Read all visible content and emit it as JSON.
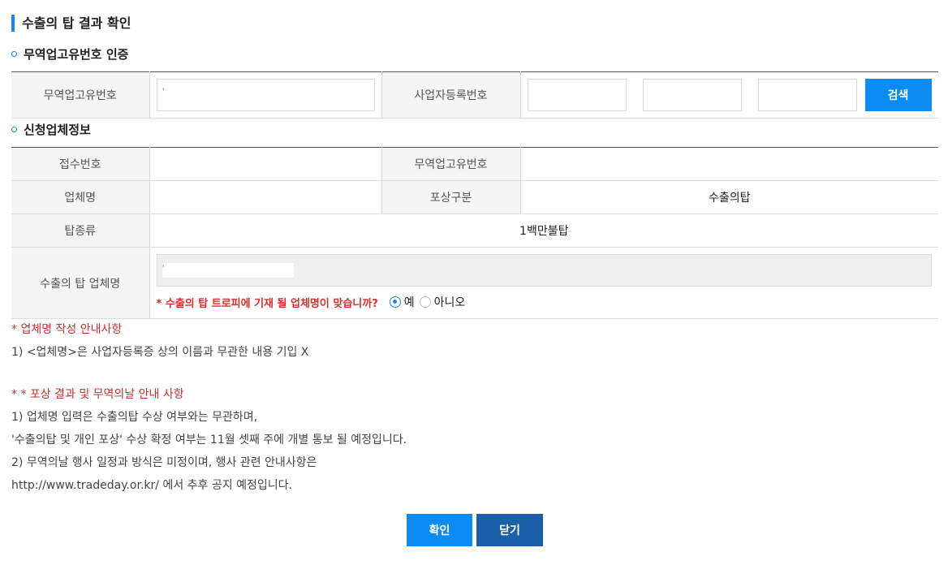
{
  "page": {
    "title": "수출의 탑 결과 확인"
  },
  "section1": {
    "title": "무역업고유번호 인증",
    "trade_id_label": "무역업고유번호",
    "trade_id_value": "'",
    "biz_reg_label": "사업자등록번호",
    "search_button": "검색"
  },
  "section2": {
    "title": "신청업체정보",
    "receipt_no_label": "접수번호",
    "receipt_no_value": "",
    "trade_id_label": "무역업고유번호",
    "trade_id_value": "",
    "company_label": "업체명",
    "company_value": "",
    "award_type_label": "포상구분",
    "award_type_value": "수출의탑",
    "tower_type_label": "탑종류",
    "tower_type_value": "1백만불탑",
    "tower_company_label": "수출의 탑 업체명",
    "tower_company_value": "'",
    "question": "* 수출의 탑 트로피에 기재 될 업체명이 맞습니까?",
    "option_yes": "예",
    "option_no": "아니오"
  },
  "notes": {
    "heading1": "* 업체명 작성 안내사항",
    "line1": "1) <업체명>은 사업자등록증 상의 이름과 무관한 내용 기입 X",
    "heading2": "* * 포상 결과 및 무역의날 안내 사항",
    "line2": "1) 업체명 입력은 수출의탑 수상 여부와는 무관하며,",
    "line3": "'수출의탑 및 개인 포상' 수상 확정 여부는 11월 셋째 주에 개별 통보 될 예정입니다.",
    "line4": "2) 무역의날 행사 일정과 방식은 미정이며, 행사 관련 안내사항은",
    "line5": "http://www.tradeday.or.kr/ 에서 추후 공지 예정입니다."
  },
  "buttons": {
    "confirm": "확인",
    "close": "닫기"
  },
  "colors": {
    "accent": "#0b8cf2",
    "dark_button": "#1a5fa8",
    "notice_red": "#c9302c"
  }
}
